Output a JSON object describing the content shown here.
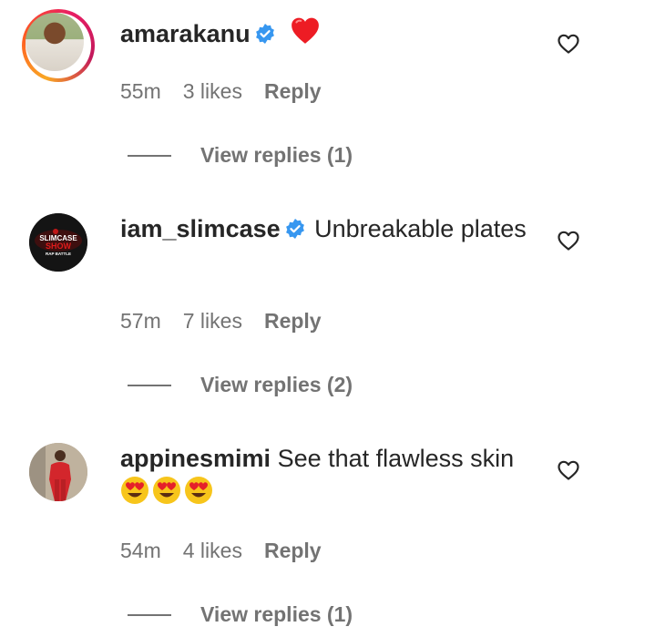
{
  "comments": [
    {
      "username": "amarakanu",
      "verified": true,
      "text": "❤️",
      "time": "55m",
      "likes": "3 likes",
      "reply": "Reply",
      "view_replies": "View replies (1)",
      "avatar_story_ring": true
    },
    {
      "username": "iam_slimcase",
      "verified": true,
      "text": "Unbreakable plates",
      "time": "57m",
      "likes": "7 likes",
      "reply": "Reply",
      "view_replies": "View replies (2)",
      "avatar_logo_text": [
        "SLIMCASE",
        "SHOW",
        "RAP BATTLE"
      ]
    },
    {
      "username": "appinesmimi",
      "verified": false,
      "text": "See that flawless skin",
      "emojis": "😍😍😍",
      "time": "54m",
      "likes": "4 likes",
      "reply": "Reply",
      "view_replies": "View replies (1)"
    }
  ],
  "colors": {
    "text": "#262626",
    "muted": "#737373",
    "verified": "#3797f0",
    "heart_red": "#ed1c24"
  },
  "icons": {
    "like": "heart-outline-icon",
    "verified": "verified-badge-icon"
  }
}
